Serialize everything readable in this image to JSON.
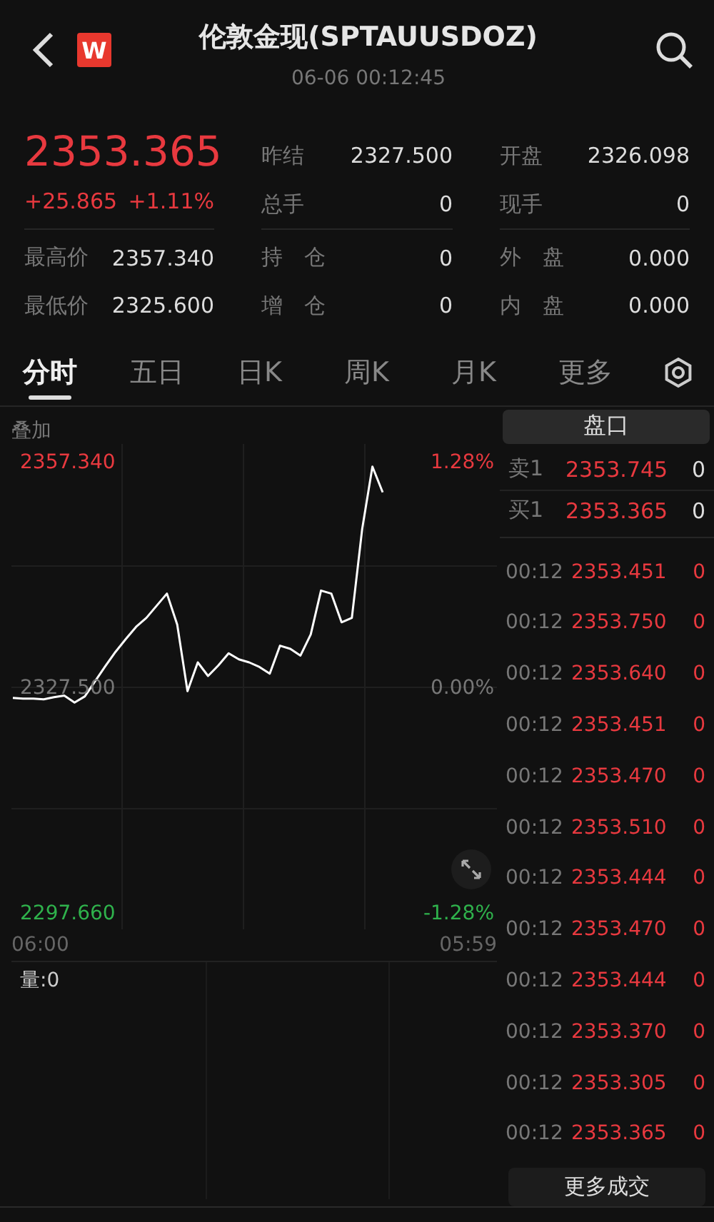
{
  "header": {
    "logo": "W",
    "title": "伦敦金现(SPTAUUSDOZ)",
    "time": "06-06 00:12:45"
  },
  "quote": {
    "price": "2353.365",
    "change": "+25.865",
    "change_pct": "+1.11%",
    "stats": [
      {
        "label": "昨结",
        "value": "2327.500"
      },
      {
        "label": "开盘",
        "value": "2326.098"
      },
      {
        "label": "总手",
        "value": "0"
      },
      {
        "label": "现手",
        "value": "0"
      },
      {
        "label": "最高价",
        "value": "2357.340"
      },
      {
        "label": "持　仓",
        "value": "0"
      },
      {
        "label": "外　盘",
        "value": "0.000"
      },
      {
        "label": "最低价",
        "value": "2325.600"
      },
      {
        "label": "增　仓",
        "value": "0"
      },
      {
        "label": "内　盘",
        "value": "0.000"
      }
    ]
  },
  "tabs": [
    {
      "label": "分时",
      "selected": true
    },
    {
      "label": "五日",
      "selected": false
    },
    {
      "label": "日K",
      "selected": false
    },
    {
      "label": "周K",
      "selected": false
    },
    {
      "label": "月K",
      "selected": false
    },
    {
      "label": "更多",
      "selected": false
    }
  ],
  "chart": {
    "overlay_label": "叠加",
    "volume_label": "量:0",
    "time_labels": [
      "06:00",
      "05:59"
    ],
    "percent_labels": [
      {
        "text": "1.28%",
        "kind": "up"
      },
      {
        "text": "0.00%",
        "kind": "flat"
      },
      {
        "text": "-1.28%",
        "kind": "down"
      }
    ],
    "chart_data": {
      "type": "line",
      "grid": true,
      "ylim": [
        2297.66,
        2357.34
      ],
      "yticks": [
        {
          "value": 2357.34,
          "label": "2357.340"
        },
        {
          "value": 2327.5,
          "label": "2327.500"
        },
        {
          "value": 2297.66,
          "label": "2297.660"
        }
      ],
      "categories": [
        null,
        null,
        null,
        null,
        null,
        null,
        null,
        null,
        null,
        null,
        null,
        null,
        null,
        null,
        null,
        null,
        null,
        null,
        null,
        null,
        null,
        null,
        null,
        null,
        null,
        null,
        null,
        null,
        null,
        null,
        null,
        null,
        null,
        null,
        null,
        null,
        null
      ],
      "series": [
        {
          "color": "#ffffff",
          "values": [
            2326.2,
            2326.1,
            2326.1,
            2326.0,
            2326.3,
            2326.5,
            2325.6,
            2326.4,
            2328.4,
            2330.4,
            2332.3,
            2334.0,
            2335.6,
            2336.8,
            2338.4,
            2340.0,
            2335.9,
            2327.1,
            2330.9,
            2329.1,
            2330.5,
            2332.1,
            2331.3,
            2330.9,
            2330.3,
            2329.4,
            2333.1,
            2332.7,
            2331.8,
            2334.6,
            2340.4,
            2340.0,
            2336.2,
            2336.8,
            2348.5,
            2356.8,
            2353.4
          ]
        }
      ]
    }
  },
  "book": {
    "title": "盘口",
    "quotes": [
      {
        "label": "卖1",
        "price": "2353.745",
        "volume": "0"
      },
      {
        "label": "买1",
        "price": "2353.365",
        "volume": "0"
      }
    ],
    "trades": [
      {
        "time": "00:12",
        "price": "2353.451",
        "volume": "0"
      },
      {
        "time": "00:12",
        "price": "2353.750",
        "volume": "0"
      },
      {
        "time": "00:12",
        "price": "2353.640",
        "volume": "0"
      },
      {
        "time": "00:12",
        "price": "2353.451",
        "volume": "0"
      },
      {
        "time": "00:12",
        "price": "2353.470",
        "volume": "0"
      },
      {
        "time": "00:12",
        "price": "2353.510",
        "volume": "0"
      },
      {
        "time": "00:12",
        "price": "2353.444",
        "volume": "0"
      },
      {
        "time": "00:12",
        "price": "2353.470",
        "volume": "0"
      },
      {
        "time": "00:12",
        "price": "2353.444",
        "volume": "0"
      },
      {
        "time": "00:12",
        "price": "2353.370",
        "volume": "0"
      },
      {
        "time": "00:12",
        "price": "2353.305",
        "volume": "0"
      },
      {
        "time": "00:12",
        "price": "2353.365",
        "volume": "0"
      }
    ],
    "more_button": "更多成交"
  }
}
